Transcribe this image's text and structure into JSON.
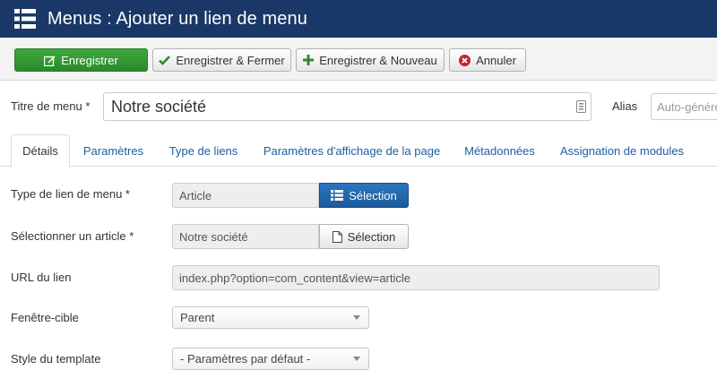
{
  "header": {
    "title": "Menus : Ajouter un lien de menu",
    "icon": "list-icon"
  },
  "toolbar": {
    "save": "Enregistrer",
    "save_close": "Enregistrer & Fermer",
    "save_new": "Enregistrer & Nouveau",
    "cancel": "Annuler"
  },
  "form": {
    "title_label": "Titre de menu *",
    "title_value": "Notre société",
    "alias_label": "Alias",
    "alias_placeholder": "Auto-générée"
  },
  "tabs": [
    {
      "label": "Détails",
      "active": true
    },
    {
      "label": "Paramètres"
    },
    {
      "label": "Type de liens"
    },
    {
      "label": "Paramètres d'affichage de la page"
    },
    {
      "label": "Métadonnées"
    },
    {
      "label": "Assignation de modules"
    }
  ],
  "details": {
    "link_type_label": "Type de lien de menu *",
    "link_type_value": "Article",
    "link_type_button": "Sélection",
    "article_label": "Sélectionner un article *",
    "article_value": "Notre société",
    "article_button": "Sélection",
    "url_label": "URL du lien",
    "url_value": "index.php?option=com_content&view=article",
    "target_label": "Fenêtre-cible",
    "target_value": "Parent",
    "template_label": "Style du template",
    "template_value": "- Paramètres par défaut -"
  },
  "colors": {
    "header_bg": "#1a3867",
    "save_green": "#2f9a2f",
    "primary_blue": "#1f62a8",
    "link_blue": "#1f5ea0"
  }
}
